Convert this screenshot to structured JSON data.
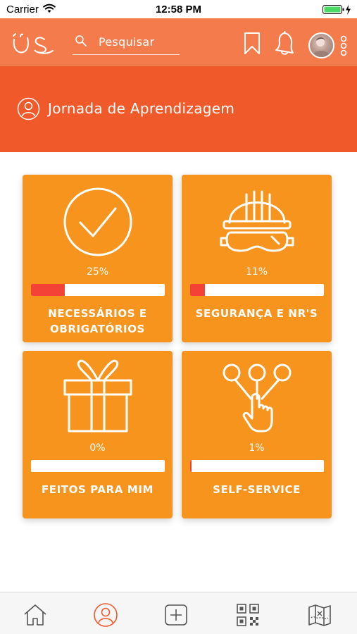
{
  "status_bar": {
    "carrier": "Carrier",
    "time": "12:58 PM"
  },
  "header": {
    "logo": "US",
    "search_placeholder": "Pesquisar"
  },
  "section": {
    "title": "Jornada de Aprendizagem"
  },
  "cards": [
    {
      "icon": "check-circle-icon",
      "progress": "25%",
      "progress_value": 25,
      "label": "NECESSÁRIOS E OBRIGATÓRIOS"
    },
    {
      "icon": "safety-gear-icon",
      "progress": "11%",
      "progress_value": 11,
      "label": "SEGURANÇA E NR'S"
    },
    {
      "icon": "gift-icon",
      "progress": "0%",
      "progress_value": 0,
      "label": "FEITOS PARA MIM"
    },
    {
      "icon": "touch-network-icon",
      "progress": "1%",
      "progress_value": 1,
      "label": "SELF-SERVICE"
    }
  ],
  "tabbar": {
    "items": [
      "home-icon",
      "profile-icon",
      "add-icon",
      "qr-code-icon",
      "map-icon"
    ],
    "active": "profile-icon"
  },
  "colors": {
    "topbar": "#f47c4c",
    "section": "#f05a2a",
    "card": "#f7941d",
    "progress_fill": "#f44336",
    "tab_active": "#f05a2a",
    "tab_inactive": "#555555"
  }
}
